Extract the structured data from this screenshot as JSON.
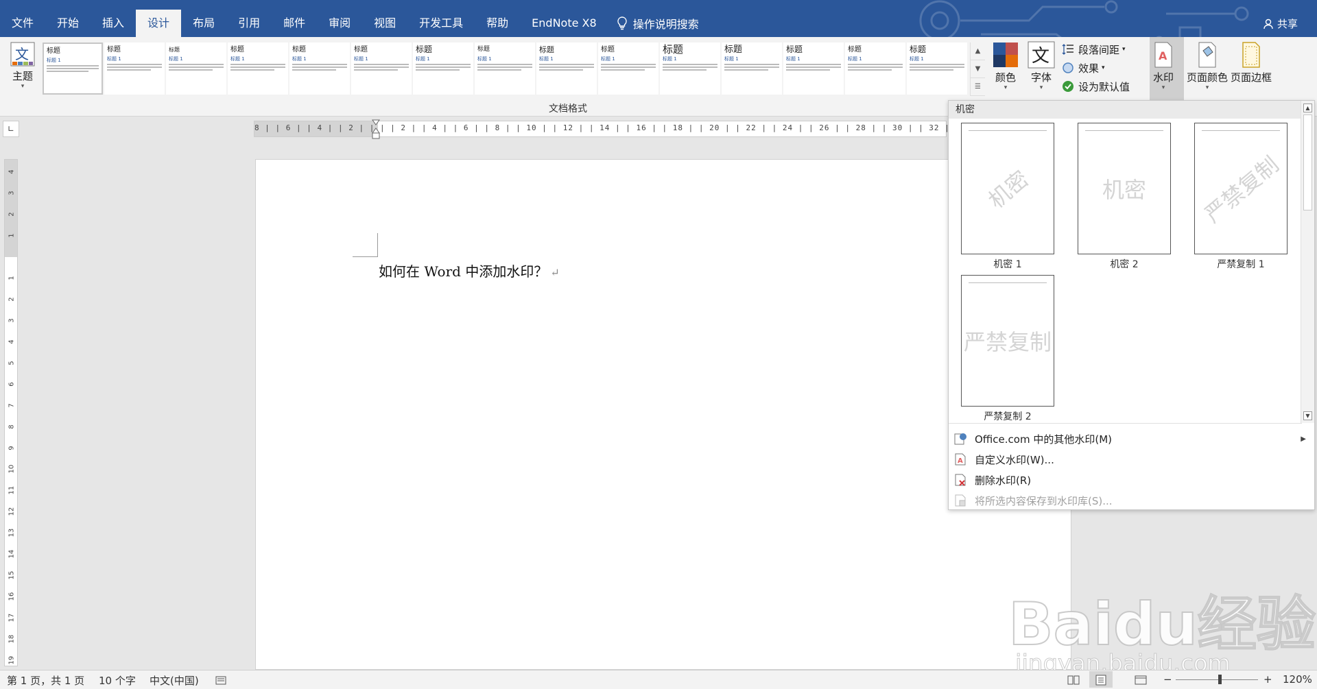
{
  "ribbon_tabs": [
    "文件",
    "开始",
    "插入",
    "设计",
    "布局",
    "引用",
    "邮件",
    "审阅",
    "视图",
    "开发工具",
    "帮助",
    "EndNote X8"
  ],
  "active_tab": "设计",
  "tell_me": "操作说明搜索",
  "share": "共享",
  "theme_button": "主题",
  "theme_icon_char": "文",
  "style_gallery_title": "标题",
  "style_gallery_sub": "标题 1",
  "document_formatting_label": "文档格式",
  "colors_button": "颜色",
  "fonts_button": "字体",
  "fonts_icon_char": "文",
  "paragraph_spacing": "段落间距",
  "effects": "效果",
  "set_as_default": "设为默认值",
  "watermark_button": "水印",
  "page_color_button": "页面颜色",
  "page_borders_button": "页面边框",
  "ruler_corner": "∟",
  "h_ruler_text": "8 | | 6 | | 4 | | 2 | | | | 2 | | 4 | | 6 | | 8 | | 10 | | 12 | | 14 | | 16 | | 18 | | 20 | | 22 | | 24 | | 26 | | 28 | | 30 | | 32 | | 34 | | 36 | |",
  "v_ruler_numbers": [
    "4",
    "3",
    "2",
    "1",
    "",
    "1",
    "2",
    "3",
    "4",
    "5",
    "6",
    "7",
    "8",
    "9",
    "10",
    "11",
    "12",
    "13",
    "14",
    "15",
    "16",
    "17",
    "18",
    "19"
  ],
  "document_text": "如何在 Word 中添加水印？",
  "paragraph_mark": "↵",
  "watermark_panel": {
    "section_header": "机密",
    "items": [
      {
        "caption": "机密 1",
        "text": "机密",
        "style": "diagonal"
      },
      {
        "caption": "机密 2",
        "text": "机密",
        "style": "horizontal"
      },
      {
        "caption": "严禁复制 1",
        "text": "严禁复制",
        "style": "diagonal"
      },
      {
        "caption": "严禁复制 2",
        "text": "严禁复制",
        "style": "horizontal"
      }
    ],
    "menu": [
      {
        "label": "Office.com 中的其他水印(M)",
        "enabled": true,
        "submenu": true
      },
      {
        "label": "自定义水印(W)...",
        "enabled": true,
        "submenu": false
      },
      {
        "label": "删除水印(R)",
        "enabled": true,
        "submenu": false
      },
      {
        "label": "将所选内容保存到水印库(S)...",
        "enabled": false,
        "submenu": false
      }
    ]
  },
  "status_bar": {
    "page": "第 1 页，共 1 页",
    "words": "10 个字",
    "language": "中文(中国)",
    "zoom_minus": "−",
    "zoom_plus": "+",
    "zoom": "120%"
  },
  "overlay_watermark": {
    "brand": "Baidu经验",
    "url": "jingyan.baidu.com"
  },
  "colors": {
    "accent": "#2b579a",
    "ribbon_bg": "#f3f3f3",
    "doc_bg": "#e6e6e6"
  }
}
